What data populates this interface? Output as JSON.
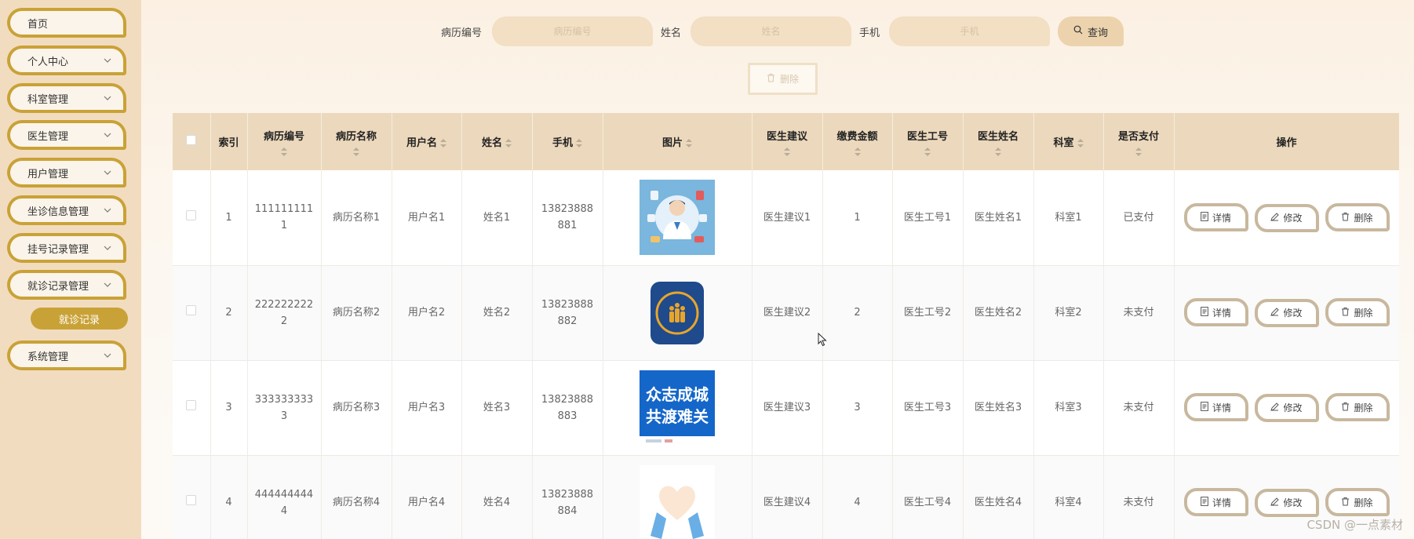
{
  "sidebar": {
    "items": [
      {
        "label": "首页",
        "has_arrow": false
      },
      {
        "label": "个人中心",
        "has_arrow": true
      },
      {
        "label": "科室管理",
        "has_arrow": true
      },
      {
        "label": "医生管理",
        "has_arrow": true
      },
      {
        "label": "用户管理",
        "has_arrow": true
      },
      {
        "label": "坐诊信息管理",
        "has_arrow": true
      },
      {
        "label": "挂号记录管理",
        "has_arrow": true
      },
      {
        "label": "就诊记录管理",
        "has_arrow": true
      },
      {
        "label": "系统管理",
        "has_arrow": true
      }
    ],
    "active_sub_item": "就诊记录"
  },
  "search": {
    "fields": [
      {
        "label": "病历编号",
        "placeholder": "病历编号"
      },
      {
        "label": "姓名",
        "placeholder": "姓名"
      },
      {
        "label": "手机",
        "placeholder": "手机"
      }
    ],
    "query_label": "查询",
    "bulk_delete_label": "删除"
  },
  "table": {
    "headers": [
      "索引",
      "病历编号",
      "病历名称",
      "用户名",
      "姓名",
      "手机",
      "图片",
      "医生建议",
      "缴费金额",
      "医生工号",
      "医生姓名",
      "科室",
      "是否支付",
      "操作"
    ],
    "rows": [
      {
        "index": "1",
        "record_no": [
          "111111111",
          "1"
        ],
        "record_name": "病历名称1",
        "username": "用户名1",
        "name": "姓名1",
        "phone": [
          "13823888",
          "881"
        ],
        "image": "doctor-illustration",
        "advice": "医生建议1",
        "amount": "1",
        "doctor_id": "医生工号1",
        "doctor_name": "医生姓名1",
        "dept": "科室1",
        "paid": "已支付"
      },
      {
        "index": "2",
        "record_no": [
          "222222222",
          "2"
        ],
        "record_name": "病历名称2",
        "username": "用户名2",
        "name": "姓名2",
        "phone": [
          "13823888",
          "882"
        ],
        "image": "medical-team-app-icon",
        "advice": "医生建议2",
        "amount": "2",
        "doctor_id": "医生工号2",
        "doctor_name": "医生姓名2",
        "dept": "科室2",
        "paid": "未支付"
      },
      {
        "index": "3",
        "record_no": [
          "333333333",
          "3"
        ],
        "record_name": "病历名称3",
        "username": "用户名3",
        "name": "姓名3",
        "phone": [
          "13823888",
          "883"
        ],
        "image": "solidarity-poster",
        "advice": "医生建议3",
        "amount": "3",
        "doctor_id": "医生工号3",
        "doctor_name": "医生姓名3",
        "dept": "科室3",
        "paid": "未支付"
      },
      {
        "index": "4",
        "record_no": [
          "444444444",
          "4"
        ],
        "record_name": "病历名称4",
        "username": "用户名4",
        "name": "姓名4",
        "phone": [
          "13823888",
          "884"
        ],
        "image": "heart-hands",
        "advice": "医生建议4",
        "amount": "4",
        "doctor_id": "医生工号4",
        "doctor_name": "医生姓名4",
        "dept": "科室4",
        "paid": "未支付"
      }
    ],
    "poster_text": [
      "众志成城",
      "共渡难关"
    ],
    "actions": {
      "detail": "详情",
      "edit": "修改",
      "delete": "删除"
    }
  },
  "watermark": "CSDN @一点素材",
  "colors": {
    "accent": "#c9a237",
    "sidebar_bg": "#f2dcc0",
    "header_bg": "#ecd9bd",
    "input_bg": "#f2dfc4"
  }
}
